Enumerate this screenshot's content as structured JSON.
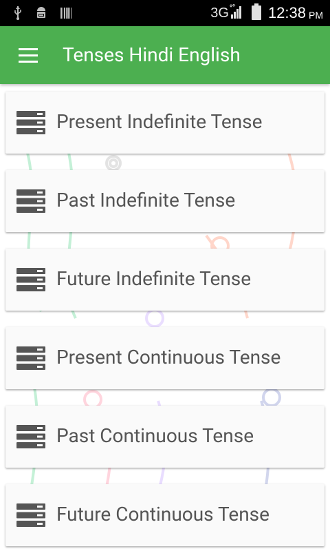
{
  "status_bar": {
    "network": "3G",
    "time": "12:38",
    "ampm": "PM",
    "icons": [
      "usb-icon",
      "android-debug-icon",
      "barcode-icon",
      "signal-icon",
      "battery-icon"
    ]
  },
  "app_bar": {
    "title": "Tenses Hindi English",
    "color": "#4caf50",
    "menu_icon": "hamburger-menu-icon"
  },
  "tense_list": {
    "item_icon": "list-icon",
    "items": [
      {
        "label": "Present Indefinite Tense"
      },
      {
        "label": "Past Indefinite Tense"
      },
      {
        "label": "Future Indefinite Tense"
      },
      {
        "label": "Present Continuous Tense"
      },
      {
        "label": "Past Continuous Tense"
      },
      {
        "label": "Future Continuous Tense"
      }
    ]
  }
}
